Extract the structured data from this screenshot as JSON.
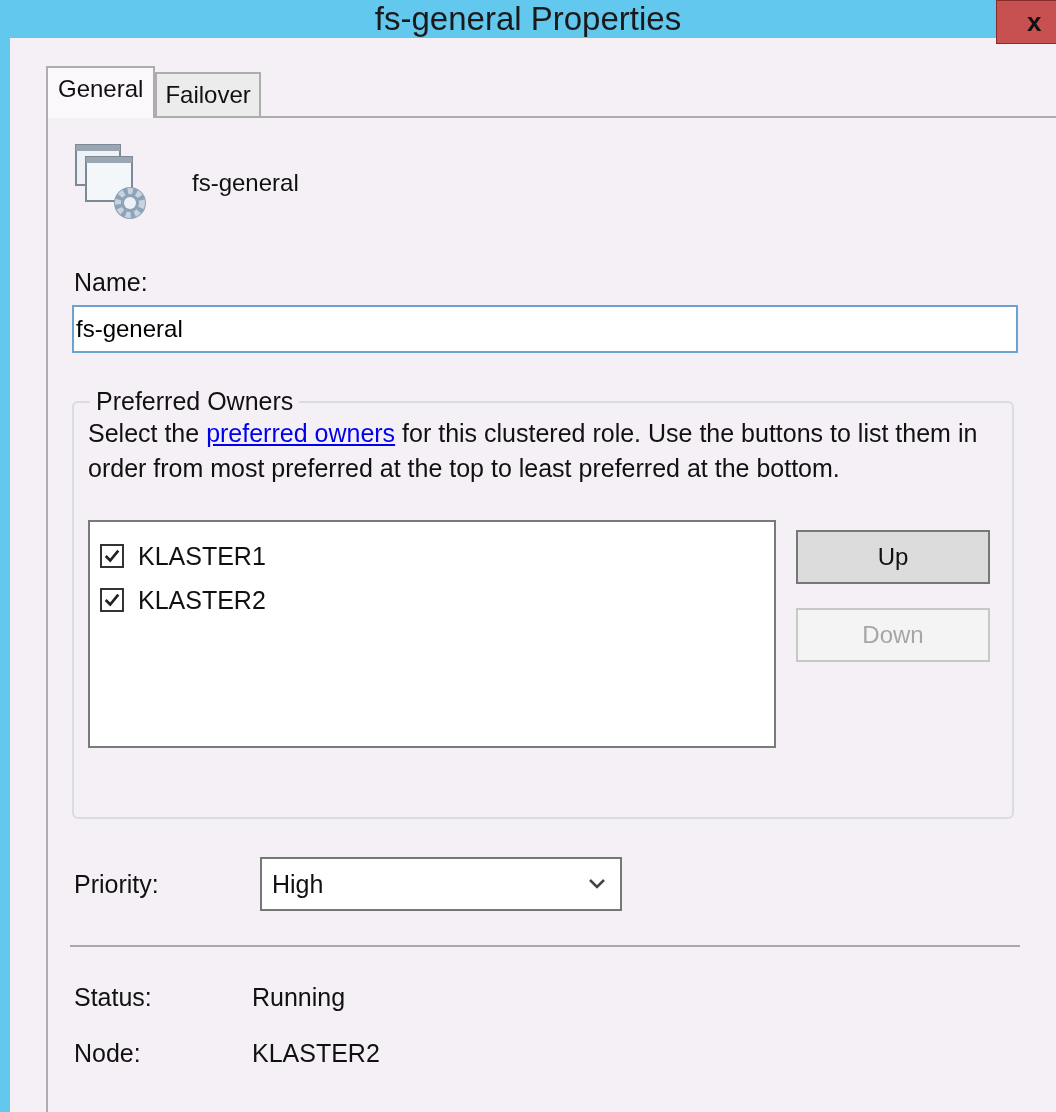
{
  "window": {
    "title": "fs-general Properties",
    "close_label": "x"
  },
  "tabs": [
    {
      "label": "General",
      "selected": true
    },
    {
      "label": "Failover",
      "selected": false
    }
  ],
  "role_name": "fs-general",
  "name_field": {
    "label": "Name:",
    "value": "fs-general"
  },
  "preferred_owners": {
    "title": "Preferred Owners",
    "description_before": "Select the ",
    "link": "preferred owners",
    "description_after": " for this clustered role. Use the buttons to list them in order from most preferred at the top to least preferred at the bottom.",
    "owners": [
      {
        "name": "KLASTER1",
        "checked": true
      },
      {
        "name": "KLASTER2",
        "checked": true
      }
    ],
    "buttons": [
      {
        "label": "Up",
        "disabled": false
      },
      {
        "label": "Down",
        "disabled": true
      }
    ]
  },
  "priority": {
    "label": "Priority:",
    "value": "High"
  },
  "info": [
    {
      "label": "Status:",
      "value": "Running"
    },
    {
      "label": "Node:",
      "value": "KLASTER2"
    }
  ]
}
